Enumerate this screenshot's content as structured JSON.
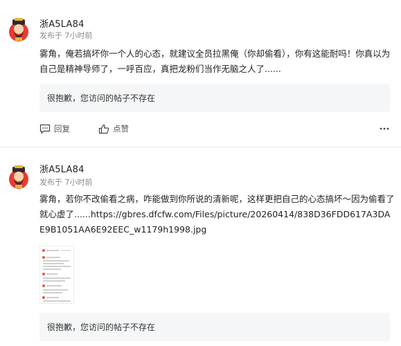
{
  "posts": [
    {
      "username": "浙A5LA84",
      "meta": "发布于 7小时前",
      "content": "雾角，俺若搞坏你一个人的心态，就建议全员拉黑俺（你却偷看），你有这能耐吗！你真以为自己是精神导师了，一呼百应，真把龙粉们当作无脑之人了......",
      "quote": "很抱歉，您访问的帖子不存在",
      "reply_label": "回复",
      "like_label": "点赞"
    },
    {
      "username": "浙A5LA84",
      "meta": "发布于 7小时前",
      "content": "雾角，若你不改偷看之病，咋能做到你所说的清新呢，这样更把自己的心态搞坏～因为偷看了就心虚了......https://gbres.dfcfw.com/Files/picture/20260414/838D36FDD617A3DAE9B1051AA6E92EEC_w1179h1998.jpg",
      "quote": "很抱歉，您访问的帖子不存在"
    }
  ],
  "icons": {
    "avatar": "caishen-avatar-icon",
    "reply": "comment-icon",
    "like": "thumbs-up-icon",
    "more": "more-icon"
  },
  "colors": {
    "username": "#222222",
    "meta": "#8a8a8a",
    "quote_bg": "#f5f6f7"
  }
}
